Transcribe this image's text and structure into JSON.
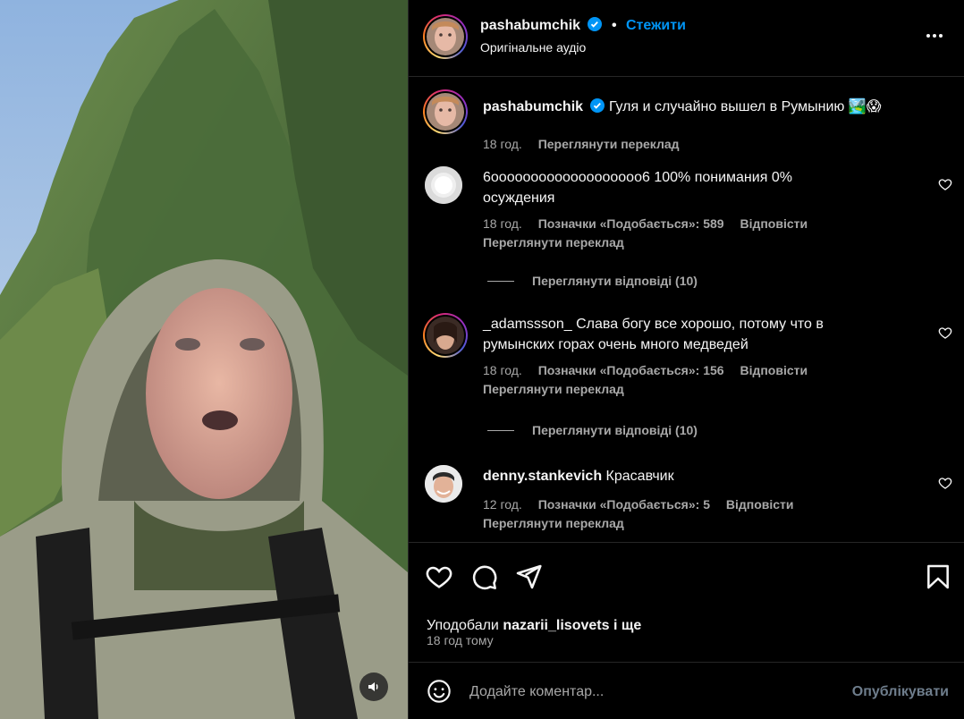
{
  "colors": {
    "accent": "#0095f6",
    "background": "#000000",
    "text_primary": "#f5f5f5",
    "text_secondary": "#a8a8a8",
    "verified_blue": "#0095f6"
  },
  "header": {
    "username": "pashabumchik",
    "separator": "•",
    "follow_label": "Стежити",
    "audio_label": "Оригінальне аудіо",
    "more_icon": "more-horizontal-icon"
  },
  "caption": {
    "username": "pashabumchik",
    "text": "Гуля и случайно вышел в Румынию 🏞️😱",
    "time": "18 год.",
    "translate": "Переглянути переклад"
  },
  "comments": [
    {
      "username": "6ooooooooooooooooooo6",
      "text": "100% понимания 0% осуждения",
      "time": "18 год.",
      "likes": "Позначки «Подобається»: 589",
      "reply": "Відповісти",
      "translate": "Переглянути переклад",
      "view_replies": "Переглянути відповіді (10)"
    },
    {
      "username": "_adamssson_",
      "text": "Слава богу все хорошо, потому что в румынских горах очень много медведей",
      "time": "18 год.",
      "likes": "Позначки «Подобається»: 156",
      "reply": "Відповісти",
      "translate": "Переглянути переклад",
      "view_replies": "Переглянути відповіді (10)"
    },
    {
      "username": "denny.stankevich",
      "text": "Красавчик",
      "time": "12 год.",
      "likes": "Позначки «Подобається»: 5",
      "reply": "Відповісти",
      "translate": "Переглянути переклад"
    }
  ],
  "actions": {
    "liked_by_prefix": "Уподобали",
    "liked_by_user": "nazarii_lisovets",
    "liked_by_suffix": "і ще",
    "time_ago": "18 год тому"
  },
  "composer": {
    "placeholder": "Додайте коментар...",
    "post_label": "Опублікувати"
  }
}
